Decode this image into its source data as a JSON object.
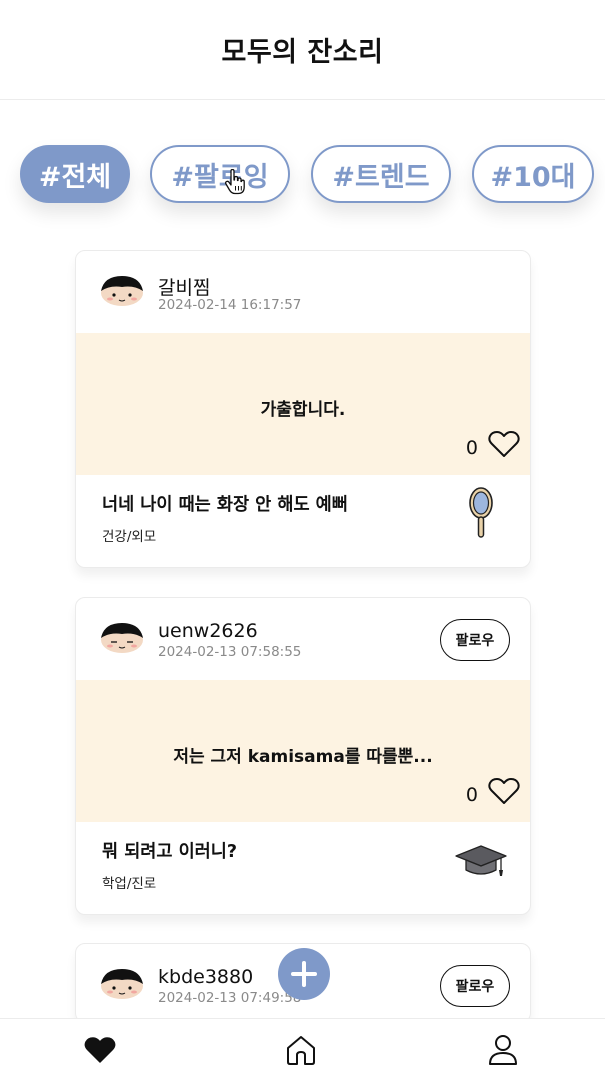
{
  "header": {
    "title": "모두의 잔소리"
  },
  "tabs": [
    {
      "label": "#전체",
      "active": true
    },
    {
      "label": "#팔로잉",
      "active": false
    },
    {
      "label": "#트렌드",
      "active": false
    },
    {
      "label": "#10대",
      "active": false
    }
  ],
  "posts": [
    {
      "username": "갈비찜",
      "timestamp": "2024-02-14 16:17:57",
      "body": "가출합니다.",
      "likes": "0",
      "title": "너네 나이 때는 화장 안 해도 예뻐",
      "category": "건강/외모",
      "category_icon": "hand-mirror-icon",
      "follow_label": ""
    },
    {
      "username": "uenw2626",
      "timestamp": "2024-02-13 07:58:55",
      "body": "저는 그저 kamisama를 따를뿐...",
      "likes": "0",
      "title": "뭐 되려고 이러니?",
      "category": "학업/진로",
      "category_icon": "graduation-cap-icon",
      "follow_label": "팔로우"
    },
    {
      "username": "kbde3880",
      "timestamp": "2024-02-13 07:49:58",
      "follow_label": "팔로우"
    }
  ],
  "nav": [
    {
      "icon": "heart-filled-icon",
      "active": true
    },
    {
      "icon": "home-icon",
      "active": false
    },
    {
      "icon": "user-icon",
      "active": false
    }
  ],
  "colors": {
    "accent": "#7f99c9",
    "post_body_bg": "#fdf3e2",
    "text": "#111111",
    "muted": "#8a8a8a"
  }
}
